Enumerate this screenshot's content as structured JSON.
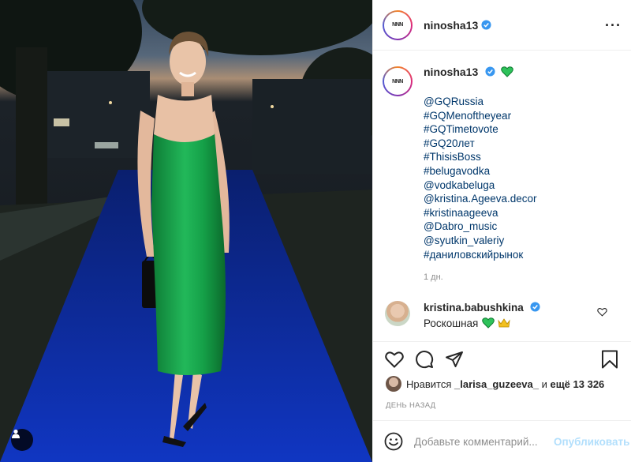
{
  "post": {
    "username": "ninosha13",
    "avatar_logo": "NNN",
    "caption_lines": [
      "@GQRussia",
      "#GQMenoftheyear",
      "#GQTimetovote",
      "#GQ20лет",
      "#ThisisBoss",
      "#belugavodka",
      "@vodkabeluga",
      "@kristina.Ageeva.decor",
      "#kristinaageeva",
      "@Dabro_music",
      "@syutkin_valeriy",
      "#даниловскийрынок"
    ],
    "caption_time": "1 дн.",
    "caption_emoji": "green-heart"
  },
  "comment": {
    "username": "kristina.babushkina",
    "text": "Роскошная",
    "emojis": [
      "green-heart",
      "crown"
    ]
  },
  "likes": {
    "prefix": "Нравится",
    "user": "_larisa_guzeeva_",
    "middle": "и",
    "others": "ещё 13 326"
  },
  "post_time": "ДЕНЬ НАЗАД",
  "add_comment": {
    "placeholder": "Добавьте комментарий...",
    "publish_label": "Опубликовать"
  },
  "icons": {
    "more": "more-options-icon",
    "like": "heart-icon",
    "comment": "comment-icon",
    "share": "share-icon",
    "save": "bookmark-icon",
    "emoji": "emoji-icon",
    "user_tag": "user-tag-icon",
    "verified": "verified-badge-icon"
  },
  "colors": {
    "link": "#00376b",
    "verified": "#3897f0",
    "secondary_text": "#8e8e8e",
    "publish_disabled": "#b2dffc",
    "dress_green": "#1aa24a",
    "carpet_blue": "#0d2ea8"
  }
}
